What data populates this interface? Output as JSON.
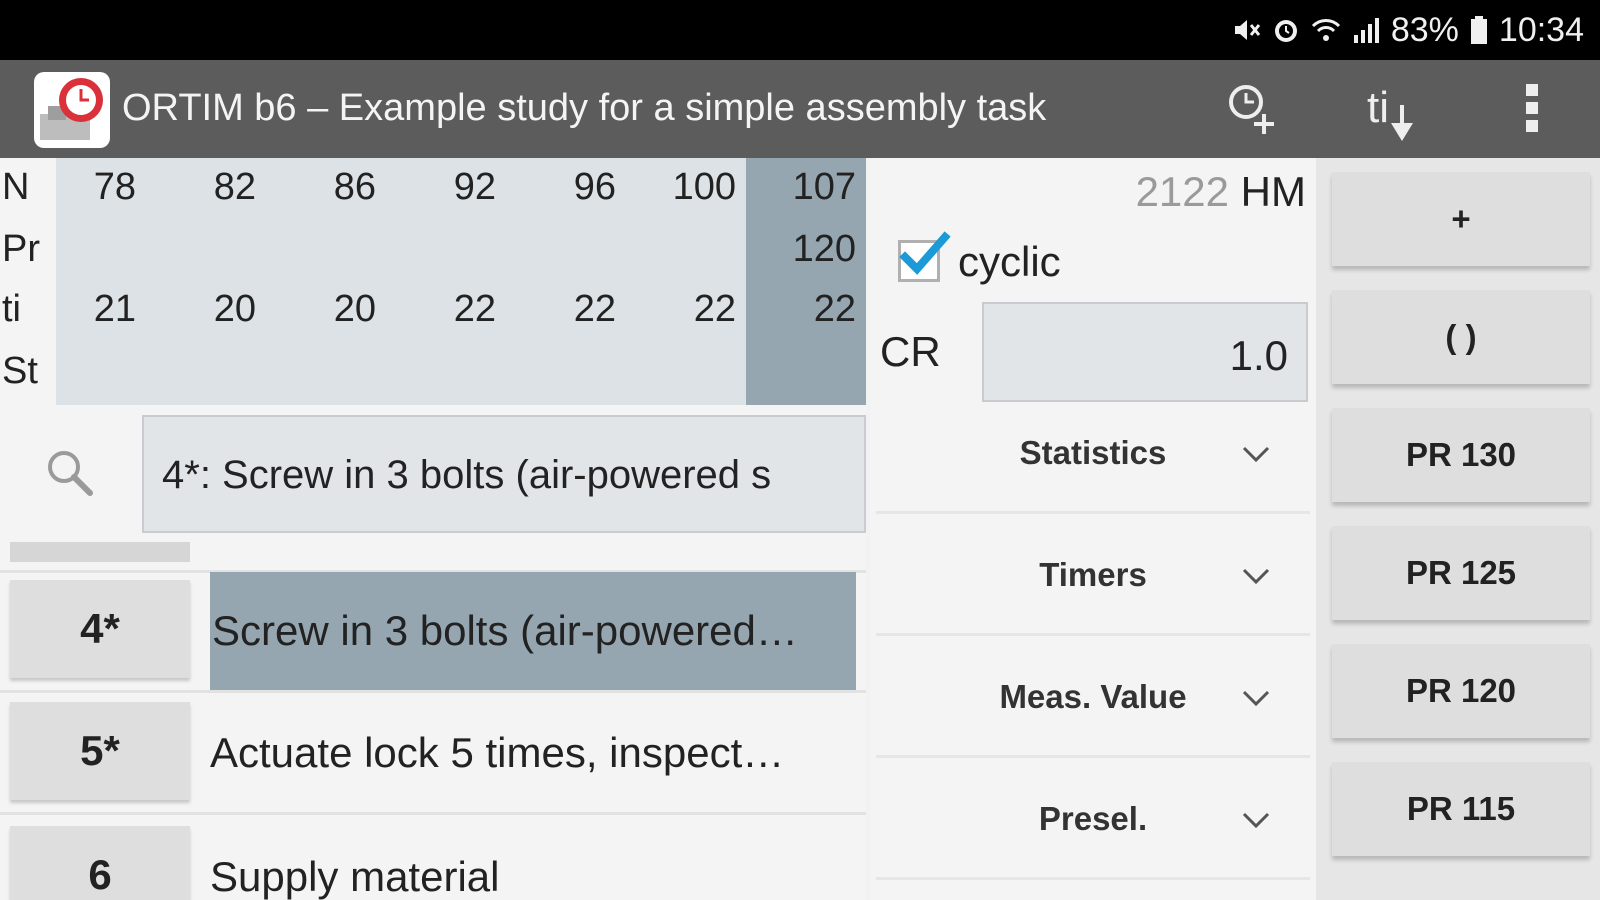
{
  "status_bar": {
    "battery": "83%",
    "time": "10:34",
    "icons": [
      "mute-icon",
      "alarm-icon",
      "wifi-icon",
      "signal-icon",
      "battery-icon"
    ]
  },
  "app_bar": {
    "title": "ORTIM b6 – Example study for a simple assembly task",
    "ti_label": "ti",
    "icons": [
      "app-logo",
      "add-timer-icon",
      "ti-sort-icon",
      "overflow-menu-icon"
    ]
  },
  "grid": {
    "row_labels": [
      "N",
      "Pr",
      "ti",
      "St"
    ],
    "columns": [
      {
        "N": "78",
        "Pr": "",
        "ti": "21"
      },
      {
        "N": "82",
        "Pr": "",
        "ti": "20"
      },
      {
        "N": "86",
        "Pr": "",
        "ti": "20"
      },
      {
        "N": "92",
        "Pr": "",
        "ti": "22"
      },
      {
        "N": "96",
        "Pr": "",
        "ti": "22"
      },
      {
        "N": "100",
        "Pr": "",
        "ti": "22"
      },
      {
        "N": "107",
        "Pr": "120",
        "ti": "22"
      }
    ],
    "highlight_color": "#95a6b0"
  },
  "search": {
    "value": "4*: Screw in 3 bolts (air-powered s"
  },
  "list": {
    "progress": 0.0,
    "rows": [
      {
        "number": "4*",
        "text": "Screw in 3 bolts (air-powered…",
        "selected": true
      },
      {
        "number": "5*",
        "text": "Actuate lock 5 times, inspect…",
        "selected": false
      },
      {
        "number": "6",
        "text": "Supply material",
        "selected": false
      }
    ]
  },
  "middle": {
    "hm_value": "2122",
    "hm_unit": "HM",
    "cyclic_label": "cyclic",
    "cyclic_checked": true,
    "cr_label": "CR",
    "cr_value": "1.0",
    "dropdowns": [
      "Statistics",
      "Timers",
      "Meas. Value",
      "Presel."
    ]
  },
  "right_buttons": [
    "+",
    "( )",
    "PR 130",
    "PR 125",
    "PR 120",
    "PR 115"
  ],
  "colors": {
    "app_bar": "#5c5c5c",
    "accent_check": "#1a9ad6",
    "logo_red": "#d9303a"
  }
}
